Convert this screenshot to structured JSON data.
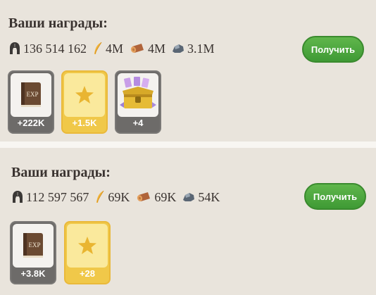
{
  "rewards": [
    {
      "title": "Ваши награды:",
      "resources": {
        "helmet": "136 514 162",
        "feather": "4M",
        "wood": "4M",
        "stone": "3.1M"
      },
      "button_label": "Получить",
      "items": [
        {
          "icon": "exp-book-icon",
          "amount": "+222K"
        },
        {
          "icon": "star-icon",
          "amount": "+1.5K"
        },
        {
          "icon": "treasure-chest-icon",
          "amount": "+4"
        }
      ]
    },
    {
      "title": "Ваши награды:",
      "resources": {
        "helmet": "112 597 567",
        "feather": "69K",
        "wood": "69K",
        "stone": "54K"
      },
      "button_label": "Получить",
      "items": [
        {
          "icon": "exp-book-icon",
          "amount": "+3.8K"
        },
        {
          "icon": "star-icon",
          "amount": "+28"
        }
      ]
    }
  ],
  "colors": {
    "panel_bg": "#e9e4dc",
    "button_green": "#4aa63c",
    "card_gray": "#6d6b69",
    "card_gold": "#f0c849"
  }
}
